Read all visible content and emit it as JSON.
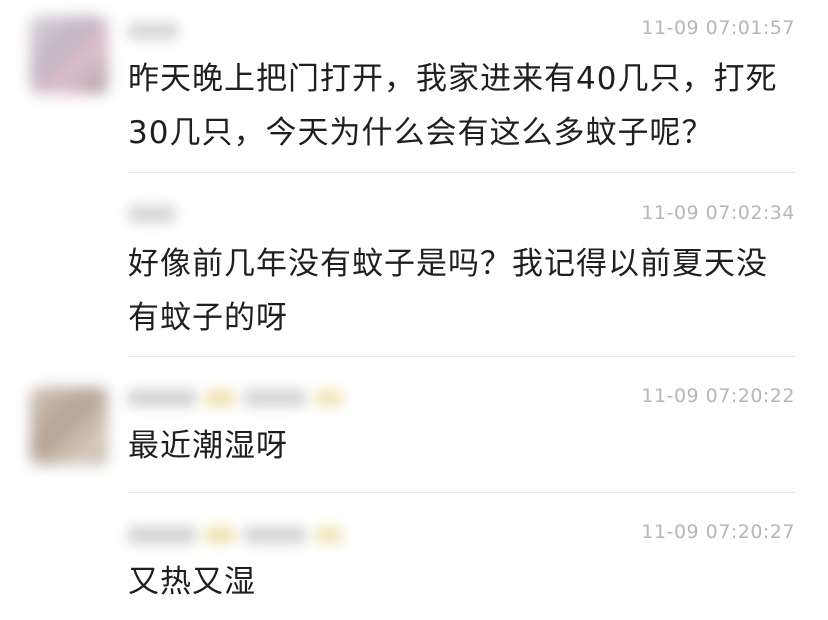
{
  "comments": [
    {
      "timestamp": "11-09 07:01:57",
      "text_lines": [
        "昨天晚上把门打开，我家进来有40几只，打死",
        "30几只，今天为什么会有这么多蚊子呢？"
      ]
    },
    {
      "timestamp": "11-09 07:02:34",
      "text_lines": [
        "好像前几年没有蚊子是吗？我记得以前夏天没",
        "有蚊子的呀"
      ]
    },
    {
      "timestamp": "11-09 07:20:22",
      "text_lines": [
        "最近潮湿呀"
      ]
    },
    {
      "timestamp": "11-09 07:20:27",
      "text_lines": [
        "又热又湿"
      ]
    }
  ],
  "colors": {
    "text": "#1f1f1f",
    "timestamp": "#b6b6b6",
    "divider": "#e6e6e6"
  }
}
